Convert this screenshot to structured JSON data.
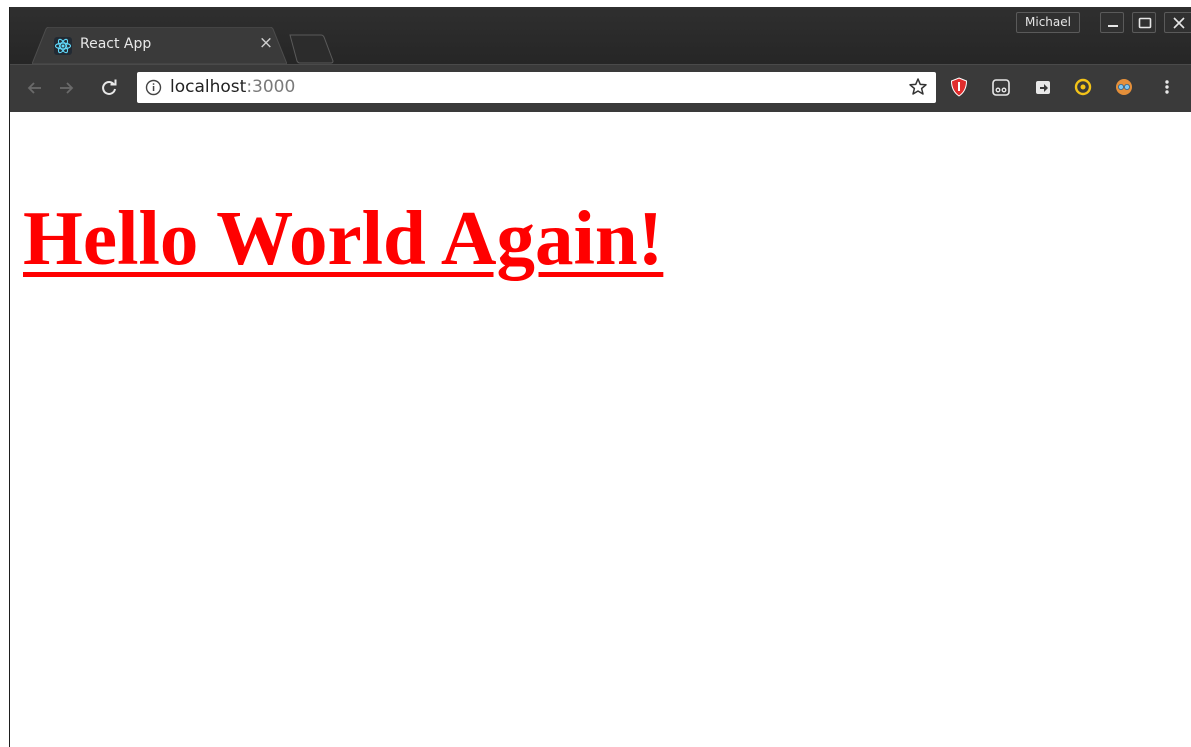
{
  "tab": {
    "title": "React App",
    "close_label": "×",
    "favicon": "react-logo-icon"
  },
  "window": {
    "profile_name": "Michael",
    "controls": [
      "minimize-icon",
      "maximize-icon",
      "close-icon"
    ]
  },
  "toolbar": {
    "back_icon": "arrow-left-icon",
    "forward_icon": "arrow-right-icon",
    "reload_icon": "reload-icon",
    "url_host": "localhost",
    "url_port": ":3000",
    "bookmark_icon": "star-icon",
    "extensions": [
      "ublock-icon",
      "extension-mask-icon",
      "extension-screenshot-icon",
      "extension-yellow-icon",
      "extension-avatar-icon"
    ],
    "menu_icon": "kebab-menu-icon"
  },
  "page": {
    "heading": "Hello World Again!",
    "heading_color": "#ff0000"
  }
}
